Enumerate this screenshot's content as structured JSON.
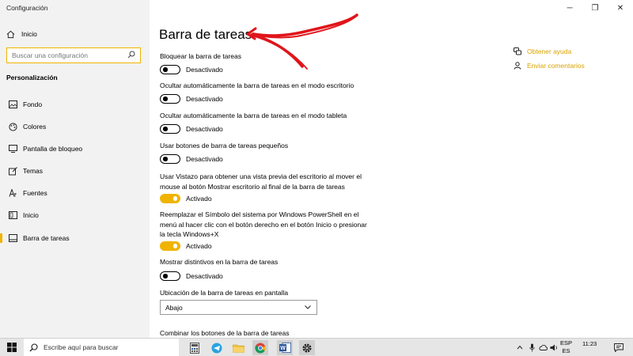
{
  "window": {
    "app_title": "Configuración",
    "controls": {
      "minimize": "─",
      "maximize": "❐",
      "close": "✕"
    }
  },
  "sidebar": {
    "home_label": "Inicio",
    "search_placeholder": "Buscar una configuración",
    "section_title": "Personalización",
    "items": [
      {
        "label": "Fondo",
        "icon": "image-icon",
        "active": false
      },
      {
        "label": "Colores",
        "icon": "palette-icon",
        "active": false
      },
      {
        "label": "Pantalla de bloqueo",
        "icon": "lock-screen-icon",
        "active": false
      },
      {
        "label": "Temas",
        "icon": "brush-icon",
        "active": false
      },
      {
        "label": "Fuentes",
        "icon": "font-icon",
        "active": false
      },
      {
        "label": "Inicio",
        "icon": "start-icon",
        "active": false
      },
      {
        "label": "Barra de tareas",
        "icon": "taskbar-icon",
        "active": true
      }
    ]
  },
  "main": {
    "title": "Barra de tareas",
    "settings": [
      {
        "label": "Bloquear la barra de tareas",
        "state": "Desactivado",
        "on": false
      },
      {
        "label": "Ocultar automáticamente la barra de tareas en el modo escritorio",
        "state": "Desactivado",
        "on": false
      },
      {
        "label": "Ocultar automáticamente la barra de tareas en el modo tableta",
        "state": "Desactivado",
        "on": false
      },
      {
        "label": "Usar botones de barra de tareas pequeños",
        "state": "Desactivado",
        "on": false
      },
      {
        "label": "Usar Vistazo para obtener una vista previa del escritorio al mover el mouse al botón Mostrar escritorio al final de la barra de tareas",
        "state": "Activado",
        "on": true
      },
      {
        "label": "Reemplazar el Símbolo del sistema por Windows PowerShell en el menú al hacer clic con el botón derecho en el botón Inicio o presionar la tecla Windows+X",
        "state": "Activado",
        "on": true
      },
      {
        "label": "Mostrar distintivos en la barra de tareas",
        "state": "Desactivado",
        "on": false
      }
    ],
    "location_label": "Ubicación de la barra de tareas en pantalla",
    "location_value": "Abajo",
    "combine_label": "Combinar los botones de la barra de tareas"
  },
  "related": {
    "help_label": "Obtener ayuda",
    "feedback_label": "Enviar comentarios"
  },
  "taskbar": {
    "search_placeholder": "Escribe aquí para buscar",
    "lang_line1": "ESP",
    "lang_line2": "ES",
    "time": "11:23"
  },
  "colors": {
    "accent": "#f0b400",
    "annotation_arrow": "#e0151b"
  }
}
